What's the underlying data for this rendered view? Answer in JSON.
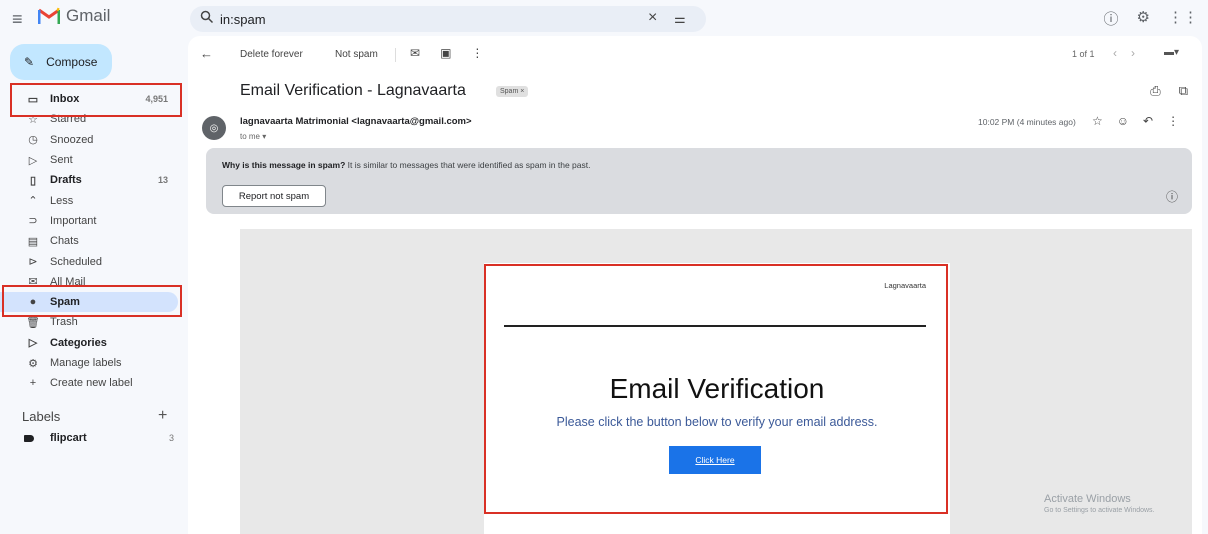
{
  "app": {
    "name": "Gmail"
  },
  "search": {
    "query": "in:spam"
  },
  "compose": {
    "label": "Compose"
  },
  "nav": [
    {
      "name": "inbox",
      "label": "Inbox",
      "count": "4,951",
      "icon": "inbox-icon",
      "glyph": "▭",
      "bold": true
    },
    {
      "name": "starred",
      "label": "Starred",
      "count": "",
      "icon": "star-icon",
      "glyph": "☆"
    },
    {
      "name": "snoozed",
      "label": "Snoozed",
      "count": "",
      "icon": "clock-icon",
      "glyph": "◷"
    },
    {
      "name": "sent",
      "label": "Sent",
      "count": "",
      "icon": "send-icon",
      "glyph": "▷"
    },
    {
      "name": "drafts",
      "label": "Drafts",
      "count": "13",
      "icon": "draft-icon",
      "glyph": "▯",
      "bold": true
    },
    {
      "name": "less",
      "label": "Less",
      "count": "",
      "icon": "chevron-up-icon",
      "glyph": "⌃"
    },
    {
      "name": "important",
      "label": "Important",
      "count": "",
      "icon": "important-icon",
      "glyph": "⊃"
    },
    {
      "name": "chats",
      "label": "Chats",
      "count": "",
      "icon": "chat-icon",
      "glyph": "▤"
    },
    {
      "name": "scheduled",
      "label": "Scheduled",
      "count": "",
      "icon": "scheduled-icon",
      "glyph": "⊳"
    },
    {
      "name": "all-mail",
      "label": "All Mail",
      "count": "",
      "icon": "all-mail-icon",
      "glyph": "✉"
    },
    {
      "name": "spam",
      "label": "Spam",
      "count": "",
      "icon": "spam-icon",
      "glyph": "●",
      "bold": true,
      "active": true
    },
    {
      "name": "trash",
      "label": "Trash",
      "count": "",
      "icon": "trash-icon",
      "glyph": "🗑"
    },
    {
      "name": "categories",
      "label": "Categories",
      "count": "",
      "icon": "label-outline-icon",
      "glyph": "▷",
      "bold": true
    },
    {
      "name": "manage-labels",
      "label": "Manage labels",
      "count": "",
      "icon": "gear-icon",
      "glyph": "⚙"
    },
    {
      "name": "create-label",
      "label": "Create new label",
      "count": "",
      "icon": "plus-icon",
      "glyph": "+"
    }
  ],
  "labels": {
    "header": "Labels",
    "items": [
      {
        "label": "flipcart",
        "count": "3"
      }
    ]
  },
  "toolbar": {
    "delete_forever": "Delete forever",
    "not_spam": "Not spam",
    "pagination": "1 of 1"
  },
  "message": {
    "subject": "Email Verification - Lagnavaarta",
    "tag": "Spam ×",
    "sender": "lagnavaarta Matrimonial <lagnavaarta@gmail.com>",
    "to": "to me ▾",
    "time": "10:02 PM (4 minutes ago)"
  },
  "spam_warning": {
    "question": "Why is this message in spam?",
    "explanation": " It is similar to messages that were identified as spam in the past.",
    "button": "Report not spam"
  },
  "email_content": {
    "brand": "Lagnavaarta",
    "title": "Email Verification",
    "subtitle": "Please click the button below to verify your email address.",
    "button": "Click Here"
  },
  "watermark": {
    "line1": "Activate Windows",
    "line2": "Go to Settings to activate Windows."
  },
  "colors": {
    "highlight_box": "#d93025",
    "active_nav": "#d3e3fd",
    "compose": "#c2e7ff",
    "link_button": "#1a73e8"
  }
}
